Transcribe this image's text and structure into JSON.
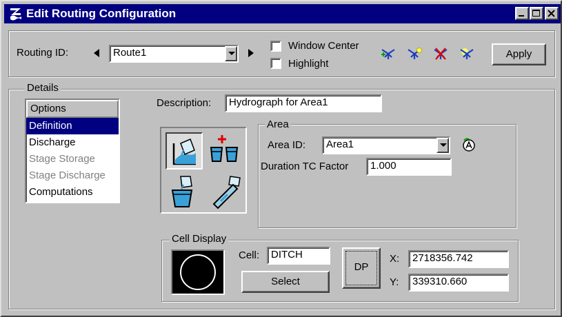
{
  "window": {
    "title": "Edit Routing Configuration"
  },
  "toolbar": {
    "routing_id_label": "Routing ID:",
    "routing_id_value": "Route1",
    "window_center_label": "Window Center",
    "highlight_label": "Highlight",
    "apply_label": "Apply"
  },
  "details": {
    "group_title": "Details",
    "options": {
      "header": "Options",
      "items": [
        {
          "label": "Definition",
          "selected": true,
          "enabled": true
        },
        {
          "label": "Discharge",
          "selected": false,
          "enabled": true
        },
        {
          "label": "Stage Storage",
          "selected": false,
          "enabled": false
        },
        {
          "label": "Stage Discharge",
          "selected": false,
          "enabled": false
        },
        {
          "label": "Computations",
          "selected": false,
          "enabled": true
        }
      ]
    },
    "description_label": "Description:",
    "description_value": "Hydrograph for Area1",
    "area": {
      "group_title": "Area",
      "area_id_label": "Area ID:",
      "area_id_value": "Area1",
      "duration_label": "Duration TC Factor",
      "duration_value": "1.000"
    },
    "cell_display": {
      "group_title": "Cell Display",
      "cell_label": "Cell:",
      "cell_value": "DITCH",
      "select_label": "Select",
      "dp_label": "DP",
      "x_label": "X:",
      "x_value": "2718356.742",
      "y_label": "Y:",
      "y_value": "339310.660"
    }
  },
  "colors": {
    "titlebar": "#000080",
    "selection": "#000080",
    "face": "#c0c0c0"
  }
}
